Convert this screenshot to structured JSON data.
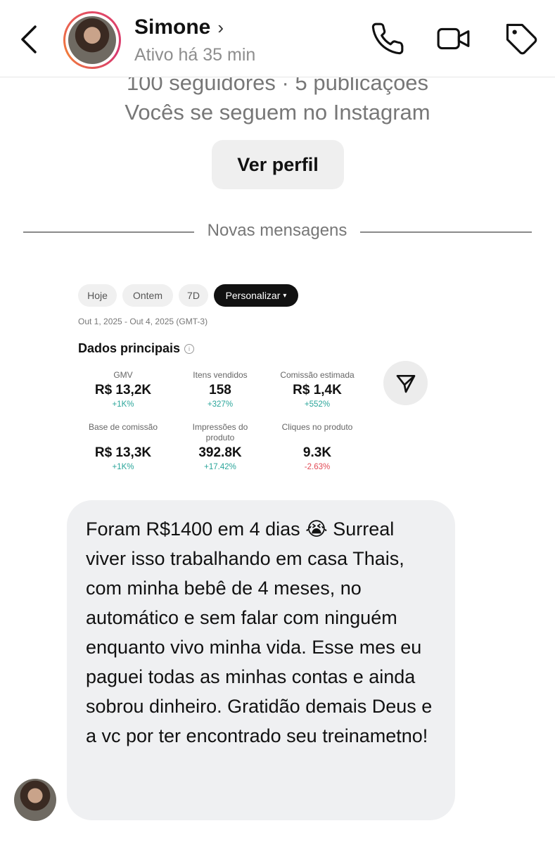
{
  "header": {
    "name": "Simone",
    "status": "Ativo há 35 min"
  },
  "profile": {
    "stats": "100 seguidores · 5 publicações",
    "follow_note": "Vocês se seguem no Instagram",
    "view_profile_label": "Ver perfil"
  },
  "divider_label": "Novas mensagens",
  "shared_image": {
    "filters": [
      "Hoje",
      "Ontem",
      "7D",
      "Personalizar"
    ],
    "date_range": "Out 1, 2025 - Out 4, 2025 (GMT-3)",
    "section_title": "Dados principais",
    "metrics": [
      {
        "label": "GMV",
        "value": "R$ 13,2K",
        "change": "+1K%"
      },
      {
        "label": "Itens vendidos",
        "value": "158",
        "change": "+327%"
      },
      {
        "label": "Comissão estimada",
        "value": "R$ 1,4K",
        "change": "+552%"
      },
      {
        "label": "Base de comissão",
        "value": "R$ 13,3K",
        "change": "+1K%"
      },
      {
        "label": "Impressões do produto",
        "value": "392.8K",
        "change": "+17.42%"
      },
      {
        "label": "Cliques no produto",
        "value": "9.3K",
        "change": "-2.63%"
      }
    ]
  },
  "message": {
    "text": "Foram R$1400 em 4 dias 😭 Surreal viver isso trabalhando em casa Thais, com minha bebê de 4 meses, no automático e sem falar com ninguém enquanto vivo minha vida. Esse mes eu paguei todas as minhas contas e ainda sobrou dinheiro. Gratidão demais Deus e a vc por ter encontrado seu treinametno!"
  },
  "colors": {
    "positive": "#2aa59a",
    "negative": "#e24a55",
    "bubble": "#eff0f2",
    "muted_text": "#8e8e8e"
  }
}
